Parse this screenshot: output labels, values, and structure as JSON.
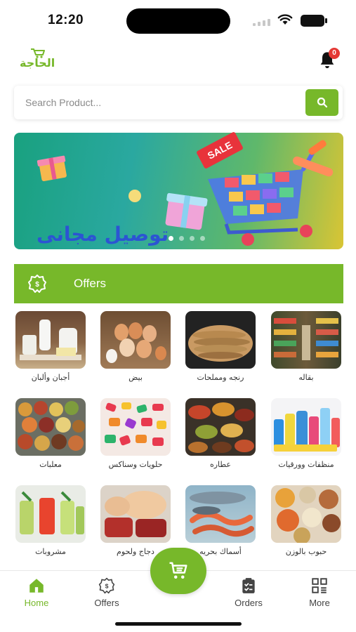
{
  "status_bar": {
    "time": "12:20"
  },
  "header": {
    "logo_text": "الحاجة",
    "notification_count": "0"
  },
  "search": {
    "placeholder": "Search Product..."
  },
  "banner": {
    "text": "توصيل مجانى",
    "sale_label": "SALE",
    "active_dot": 0
  },
  "offers": {
    "label": "Offers"
  },
  "categories": [
    {
      "label": "أجبان وألبان",
      "icon": "dairy-image"
    },
    {
      "label": "بيض",
      "icon": "eggs-image"
    },
    {
      "label": "رنجه ومملحات",
      "icon": "herring-image"
    },
    {
      "label": "بقاله",
      "icon": "grocery-image"
    },
    {
      "label": "معلبات",
      "icon": "canned-goods-image"
    },
    {
      "label": "حلويات وسناكس",
      "icon": "sweets-image"
    },
    {
      "label": "عطاره",
      "icon": "spices-image"
    },
    {
      "label": "منظفات وورقيات",
      "icon": "cleaners-image"
    },
    {
      "label": "مشروبات",
      "icon": "drinks-image"
    },
    {
      "label": "دجاج ولحوم",
      "icon": "meat-image"
    },
    {
      "label": "أسماك بحريه",
      "icon": "seafood-image"
    },
    {
      "label": "حبوب بالوزن",
      "icon": "grains-image"
    }
  ],
  "nav": {
    "home": "Home",
    "offers": "Offers",
    "orders": "Orders",
    "more": "More"
  },
  "colors": {
    "accent": "#77b82a",
    "badge": "#e53935",
    "banner_text": "#2c54d3"
  }
}
